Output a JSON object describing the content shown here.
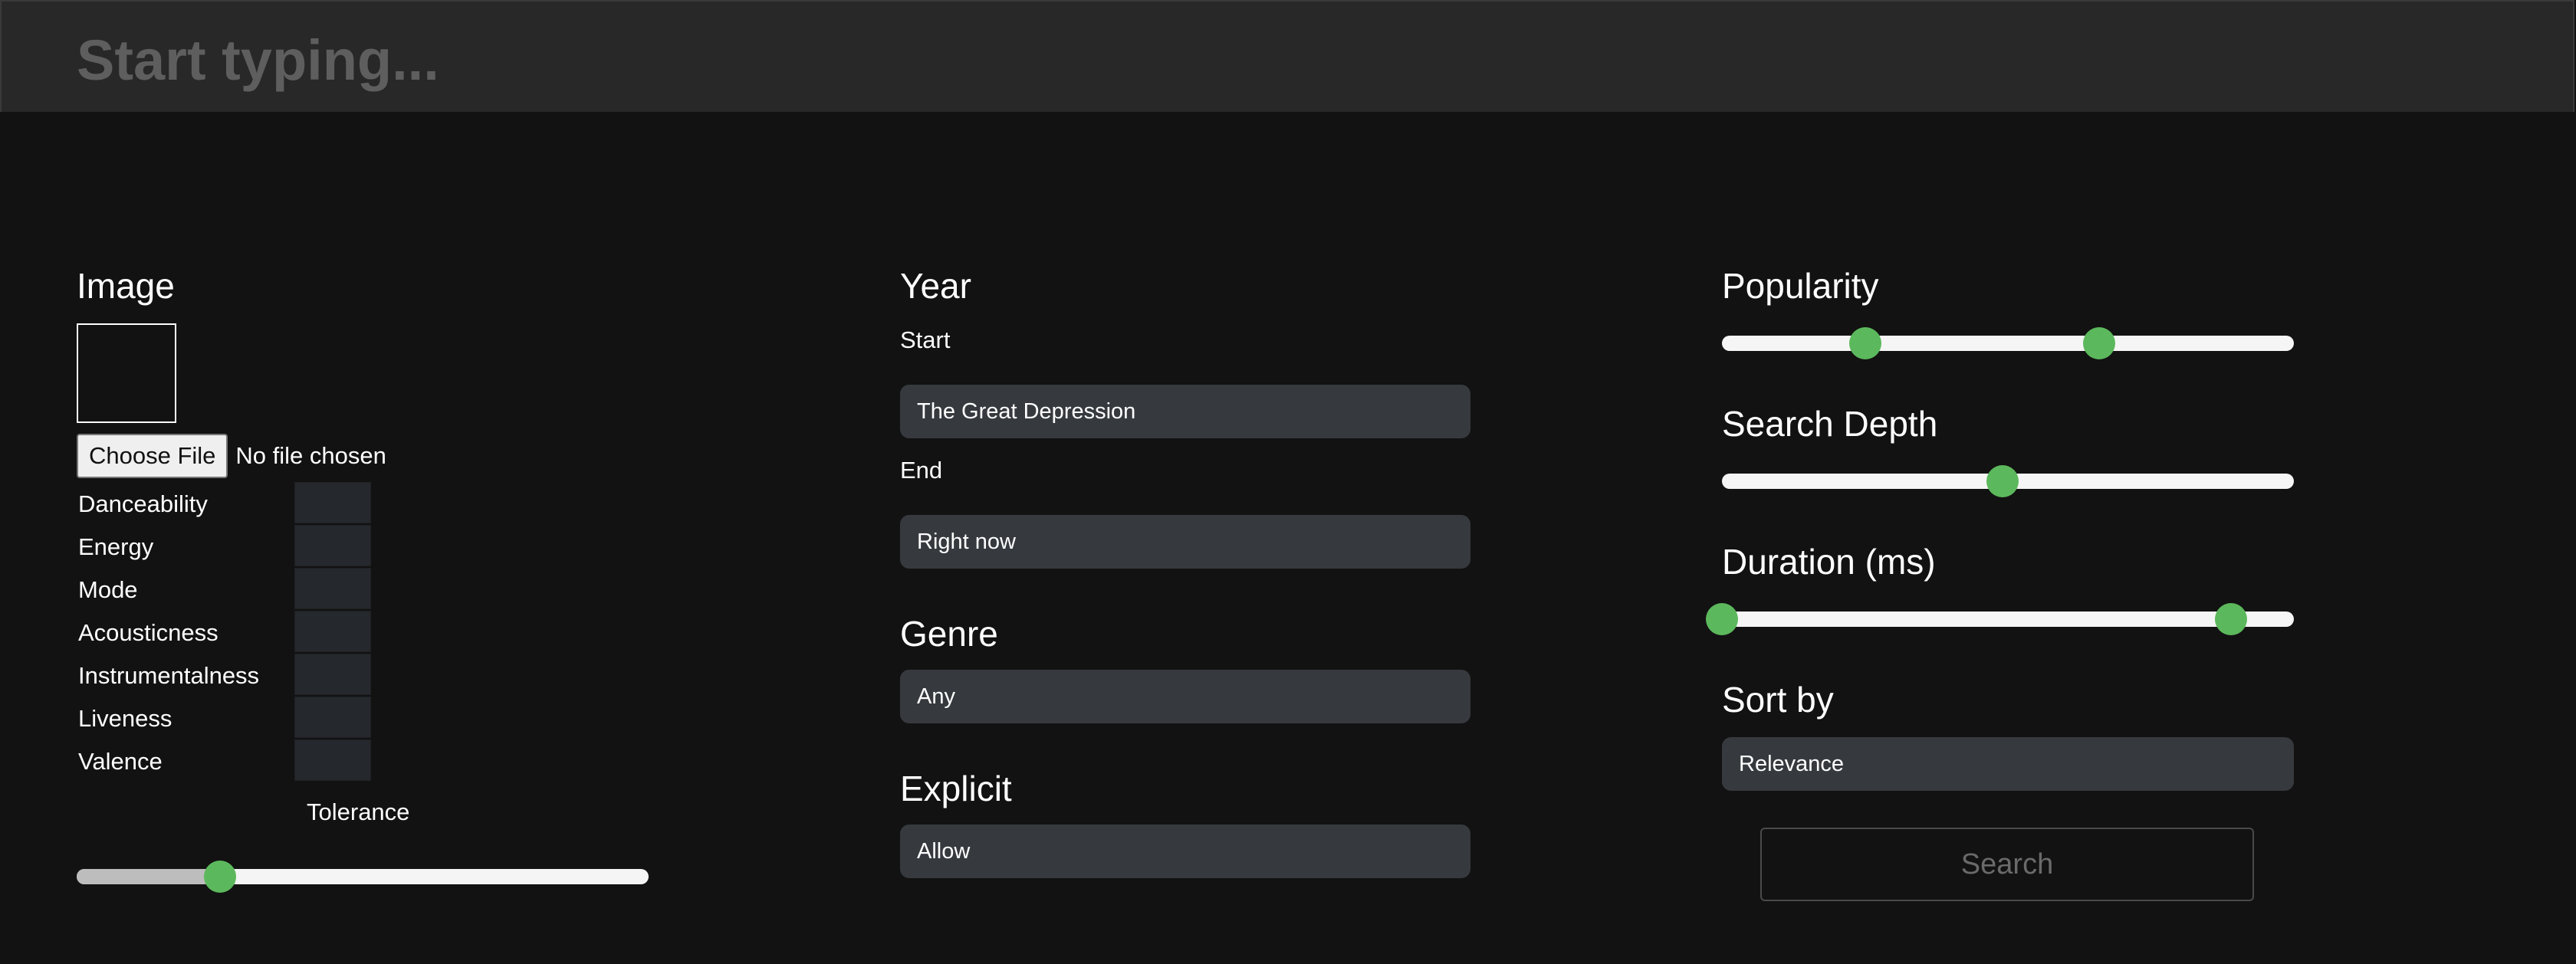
{
  "search": {
    "placeholder": "Start typing..."
  },
  "image": {
    "title": "Image",
    "choose_file_label": "Choose File",
    "file_status": "No file chosen",
    "features": [
      {
        "label": "Danceability"
      },
      {
        "label": "Energy"
      },
      {
        "label": "Mode"
      },
      {
        "label": "Acousticness"
      },
      {
        "label": "Instrumentalness"
      },
      {
        "label": "Liveness"
      },
      {
        "label": "Valence"
      }
    ],
    "tolerance_label": "Tolerance",
    "tolerance_value": 0.25
  },
  "year": {
    "title": "Year",
    "start_label": "Start",
    "start_value": "The Great Depression",
    "end_label": "End",
    "end_value": "Right now"
  },
  "genre": {
    "title": "Genre",
    "value": "Any"
  },
  "explicit": {
    "title": "Explicit",
    "value": "Allow"
  },
  "popularity": {
    "title": "Popularity",
    "low": 0.25,
    "high": 0.66
  },
  "search_depth": {
    "title": "Search Depth",
    "value": 0.49
  },
  "duration": {
    "title": "Duration (ms)",
    "low": 0.0,
    "high": 0.89
  },
  "sort_by": {
    "title": "Sort by",
    "value": "Relevance"
  },
  "search_button_label": "Search",
  "colors": {
    "accent": "#5cb85c",
    "background": "#121212",
    "top_bar": "#282828",
    "field": "#363a3e"
  }
}
